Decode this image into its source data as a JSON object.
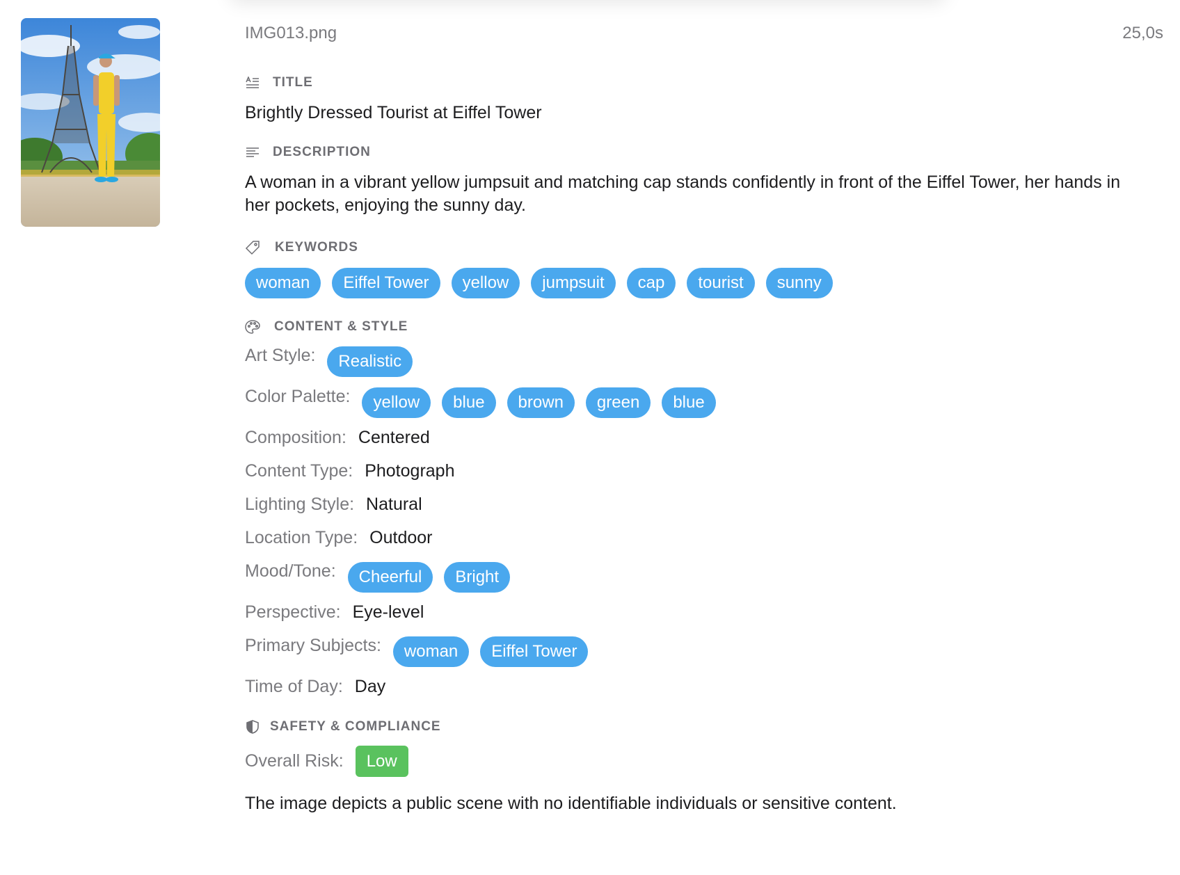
{
  "file": {
    "name": "IMG013.png",
    "duration": "25,0s"
  },
  "title_section": {
    "heading": "TITLE",
    "text": "Brightly Dressed Tourist at Eiffel Tower"
  },
  "description_section": {
    "heading": "DESCRIPTION",
    "text": "A woman in a vibrant yellow jumpsuit and matching cap stands confidently in front of the Eiffel Tower, her hands in her pockets, enjoying the sunny day."
  },
  "keywords_section": {
    "heading": "KEYWORDS",
    "items": [
      "woman",
      "Eiffel Tower",
      "yellow",
      "jumpsuit",
      "cap",
      "tourist",
      "sunny"
    ]
  },
  "content_style": {
    "heading": "CONTENT & STYLE",
    "art_style": {
      "label": "Art Style:",
      "tags": [
        "Realistic"
      ]
    },
    "color_palette": {
      "label": "Color Palette:",
      "tags": [
        "yellow",
        "blue",
        "brown",
        "green",
        "blue"
      ]
    },
    "composition": {
      "label": "Composition:",
      "value": "Centered"
    },
    "content_type": {
      "label": "Content Type:",
      "value": "Photograph"
    },
    "lighting_style": {
      "label": "Lighting Style:",
      "value": "Natural"
    },
    "location_type": {
      "label": "Location Type:",
      "value": "Outdoor"
    },
    "mood_tone": {
      "label": "Mood/Tone:",
      "tags": [
        "Cheerful",
        "Bright"
      ]
    },
    "perspective": {
      "label": "Perspective:",
      "value": "Eye-level"
    },
    "primary_subjects": {
      "label": "Primary Subjects:",
      "tags": [
        "woman",
        "Eiffel Tower"
      ]
    },
    "time_of_day": {
      "label": "Time of Day:",
      "value": "Day"
    }
  },
  "safety": {
    "heading": "SAFETY & COMPLIANCE",
    "risk_label": "Overall Risk:",
    "risk_value": "Low",
    "summary": "The image depicts a public scene with no identifiable individuals or sensitive content."
  },
  "colors": {
    "pill_blue": "#4aa8ee",
    "risk_green": "#5ac25e",
    "label_gray": "#7a7a7e"
  },
  "icons": {
    "title": "text-format-icon",
    "description": "paragraph-lines-icon",
    "keywords": "tag-icon",
    "content_style": "palette-icon",
    "safety": "shield-icon"
  }
}
